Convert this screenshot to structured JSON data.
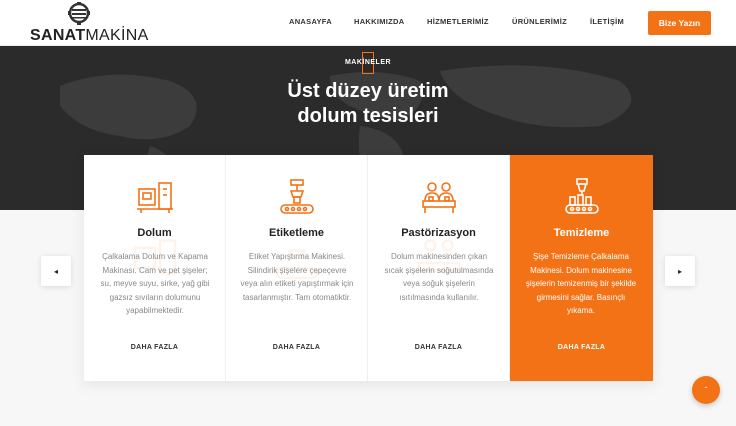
{
  "brand": {
    "name_bold": "SANAT",
    "name_light": "MAKİNA",
    "accent": "#f47216"
  },
  "nav": {
    "items": [
      {
        "label": "ANASAYFA"
      },
      {
        "label": "HAKKIMIZDA"
      },
      {
        "label": "HİZMETLERİMİZ"
      },
      {
        "label": "ÜRÜNLERİMİZ"
      },
      {
        "label": "İLETİŞİM"
      }
    ],
    "cta_label": "Bize Yazın"
  },
  "hero": {
    "eyebrow": "MAKİNELER",
    "title_line1": "Üst düzey üretim",
    "title_line2": "dolum tesisleri"
  },
  "cards": [
    {
      "icon": "filling-machine-icon",
      "title": "Dolum",
      "description": "Çalkalama Dolum ve Kapama Makinası. Cam ve pet şişeler; su, meyve suyu, sirke, yağ gibi gazsız sıvıların dolumunu yapabilmektedir.",
      "link": "DAHA FAZLA"
    },
    {
      "icon": "labeling-machine-icon",
      "title": "Etiketleme",
      "description": "Etiket Yapıştırma Makinesi. Silindirik şişelere çepeçevre veya alın etiketi yapıştırmak için tasarlanmıştır. Tam otomatiktir.",
      "link": "DAHA FAZLA"
    },
    {
      "icon": "pasteurization-icon",
      "title": "Pastörizasyon",
      "description": "Dolum makinesinden çıkan sıcak şişelerin soğutulmasında veya soğuk şişelerin ısıtılmasında kullanılır.",
      "link": "DAHA FAZLA"
    },
    {
      "icon": "cleaning-machine-icon",
      "title": "Temizleme",
      "description": "Şişe Temizleme Çalkalama Makinesi. Dolum makinesine şişelerin temizenmiş bir şekilde girmesini sağlar. Basınçlı yıkama.",
      "link": "DAHA FAZLA",
      "active": true
    }
  ],
  "slider": {
    "prev_icon": "◂",
    "next_icon": "▸"
  },
  "scroll_top_icon": "ˆ"
}
